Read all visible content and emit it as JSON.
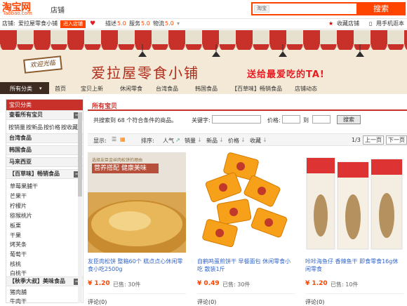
{
  "header": {
    "logo_cn": "淘宝网",
    "logo_en": "Taobao.com",
    "shop_label": "店铺",
    "search_scope": "淘宝",
    "search_placeholder": "",
    "search_button": "搜索"
  },
  "infobar": {
    "shop_prefix": "店铺:",
    "shop_name": "爱拉屋零食小铺",
    "enter_shop": "进入店铺",
    "desc_label": "描述",
    "desc_score": "5.0",
    "service_label": "服务",
    "service_score": "5.0",
    "logistics_label": "物流",
    "logistics_score": "5.0",
    "favorite_shop": "收藏店铺",
    "mobile_shop": "用手机逛本店"
  },
  "banner": {
    "welcome_sign": "欢迎光临",
    "title": "爱拉屋零食小铺",
    "slogan": "送给最爱吃的TA!"
  },
  "nav": {
    "items": [
      "所有分类",
      "首页",
      "宝贝上新",
      "休闲零食",
      "台湾食品",
      "韩国食品",
      "【百草味】畅销食品",
      "店铺动态"
    ]
  },
  "sidebar": {
    "title": "宝贝分类",
    "view_all": "查看所有宝贝",
    "sort_links": [
      "按销量",
      "按新品",
      "按价格",
      "按收藏"
    ],
    "sections": [
      {
        "label": "台湾食品"
      },
      {
        "label": "韩国食品"
      },
      {
        "label": "马来西亚"
      },
      {
        "label": "【百草味】畅销食品",
        "items": [
          "草莓果脯干",
          "芒果干",
          "柠檬片",
          "猕猴桃片",
          "板栗",
          "干果",
          "烤芙条",
          "葡萄干",
          "核桃",
          "白桃干"
        ]
      },
      {
        "label": "【秋季大叔】美味食品",
        "items": [
          "猪肉脯",
          "牛肉干"
        ]
      }
    ]
  },
  "main": {
    "title": "所有宝贝",
    "count_text": "共搜索到 68 个符合条件的商品。",
    "keyword_label": "关键字:",
    "price_label": "价格:",
    "to_label": "到",
    "search_button": "搜索",
    "display_label": "显示:",
    "sort_label": "排序:",
    "sort_options": [
      "人气",
      "销量",
      "新品",
      "价格",
      "收藏"
    ],
    "page_indicator": "1/3",
    "prev_page": "上一页",
    "next_page": "下一页"
  },
  "products": [
    {
      "image_caption_1": "选择友臣金丝肉松饼的理由",
      "image_caption_2": "营养搭配  健康美味",
      "title": "友臣肉松饼 整箱60个 糕点点心休闲零食小吃2500g",
      "price": "¥ 1.20",
      "sold": "已售: 30件",
      "reviews": "评论(0)"
    },
    {
      "image_caption_1": "",
      "image_caption_2": "",
      "title": "自鹤鸣蛋煎饼干 早餐面包 休闲零食小吃 散装1斤",
      "price": "¥ 0.49",
      "sold": "已售: 30件",
      "reviews": "评论(0)"
    },
    {
      "image_caption_1": "",
      "image_caption_2": "",
      "title": "咔咔海鱼仔 香辣鱼干 即食零食16g休闲零食",
      "price": "¥ 1.20",
      "sold": "已售: 10件",
      "reviews": "评论(0)"
    }
  ],
  "colors": {
    "taobao_orange": "#ff4400",
    "shop_red": "#c8302a",
    "banner_beige": "#f3e9d6",
    "nav_dark": "#3d2b22",
    "link_blue": "#3366cc"
  }
}
